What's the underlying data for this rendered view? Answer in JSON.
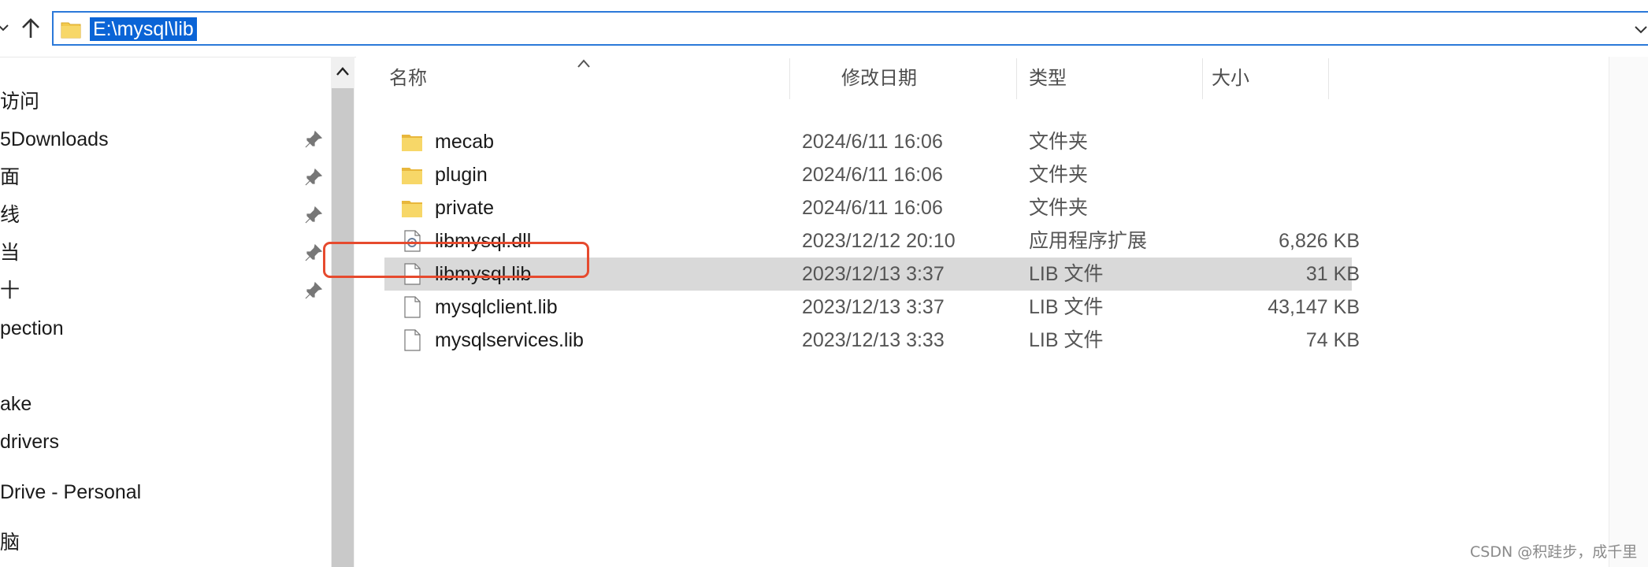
{
  "address_bar": {
    "path": "E:\\mysql\\lib"
  },
  "nav_pane": {
    "items": [
      {
        "label": "访问",
        "pinned": false
      },
      {
        "label": "5Downloads",
        "pinned": true
      },
      {
        "label": "面",
        "pinned": true
      },
      {
        "label": "线",
        "pinned": true
      },
      {
        "label": "当",
        "pinned": true
      },
      {
        "label": "十",
        "pinned": true
      },
      {
        "label": "pection",
        "pinned": false
      },
      {
        "label": "ake",
        "pinned": false
      },
      {
        "label": "drivers",
        "pinned": false
      },
      {
        "label": "Drive - Personal",
        "pinned": false
      },
      {
        "label": "脑",
        "pinned": false
      }
    ]
  },
  "file_list": {
    "columns": {
      "name": "名称",
      "date": "修改日期",
      "type": "类型",
      "size": "大小"
    },
    "rows": [
      {
        "icon": "folder-icon",
        "name": "mecab",
        "date": "2024/6/11 16:06",
        "type": "文件夹",
        "size": ""
      },
      {
        "icon": "folder-icon",
        "name": "plugin",
        "date": "2024/6/11 16:06",
        "type": "文件夹",
        "size": ""
      },
      {
        "icon": "folder-icon",
        "name": "private",
        "date": "2024/6/11 16:06",
        "type": "文件夹",
        "size": ""
      },
      {
        "icon": "dll-file-icon",
        "name": "libmysql.dll",
        "date": "2023/12/12 20:10",
        "type": "应用程序扩展",
        "size": "6,826 KB"
      },
      {
        "icon": "file-icon",
        "name": "libmysql.lib",
        "date": "2023/12/13 3:37",
        "type": "LIB 文件",
        "size": "31 KB",
        "selected": true
      },
      {
        "icon": "file-icon",
        "name": "mysqlclient.lib",
        "date": "2023/12/13 3:37",
        "type": "LIB 文件",
        "size": "43,147 KB"
      },
      {
        "icon": "file-icon",
        "name": "mysqlservices.lib",
        "date": "2023/12/13 3:33",
        "type": "LIB 文件",
        "size": "74 KB"
      }
    ]
  },
  "colors": {
    "selection": "#d9d9d9",
    "annotation_red": "#e64a2e",
    "address_highlight": "#0a64d6",
    "folder": "#f2c94c"
  },
  "watermark": "CSDN @积跬步，成千里"
}
